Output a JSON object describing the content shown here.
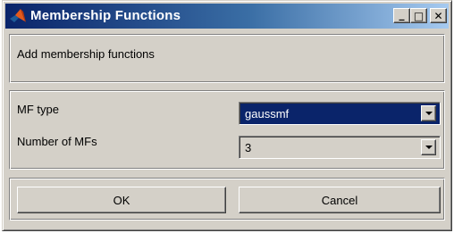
{
  "window": {
    "title": "Membership Functions",
    "controls": {
      "minimize": "_",
      "maximize": "□",
      "close": "✕"
    }
  },
  "info_panel": {
    "text": "Add membership functions"
  },
  "settings": {
    "mf_type_label": "MF type",
    "mf_type_value": "gaussmf",
    "num_mfs_label": "Number of MFs",
    "num_mfs_value": "3"
  },
  "buttons": {
    "ok": "OK",
    "cancel": "Cancel"
  },
  "colors": {
    "title_start": "#0a246a",
    "title_end": "#a6caf0",
    "face": "#d4d0c8",
    "selection": "#0a246a"
  },
  "icons": {
    "app": "matlab-logo-icon"
  }
}
